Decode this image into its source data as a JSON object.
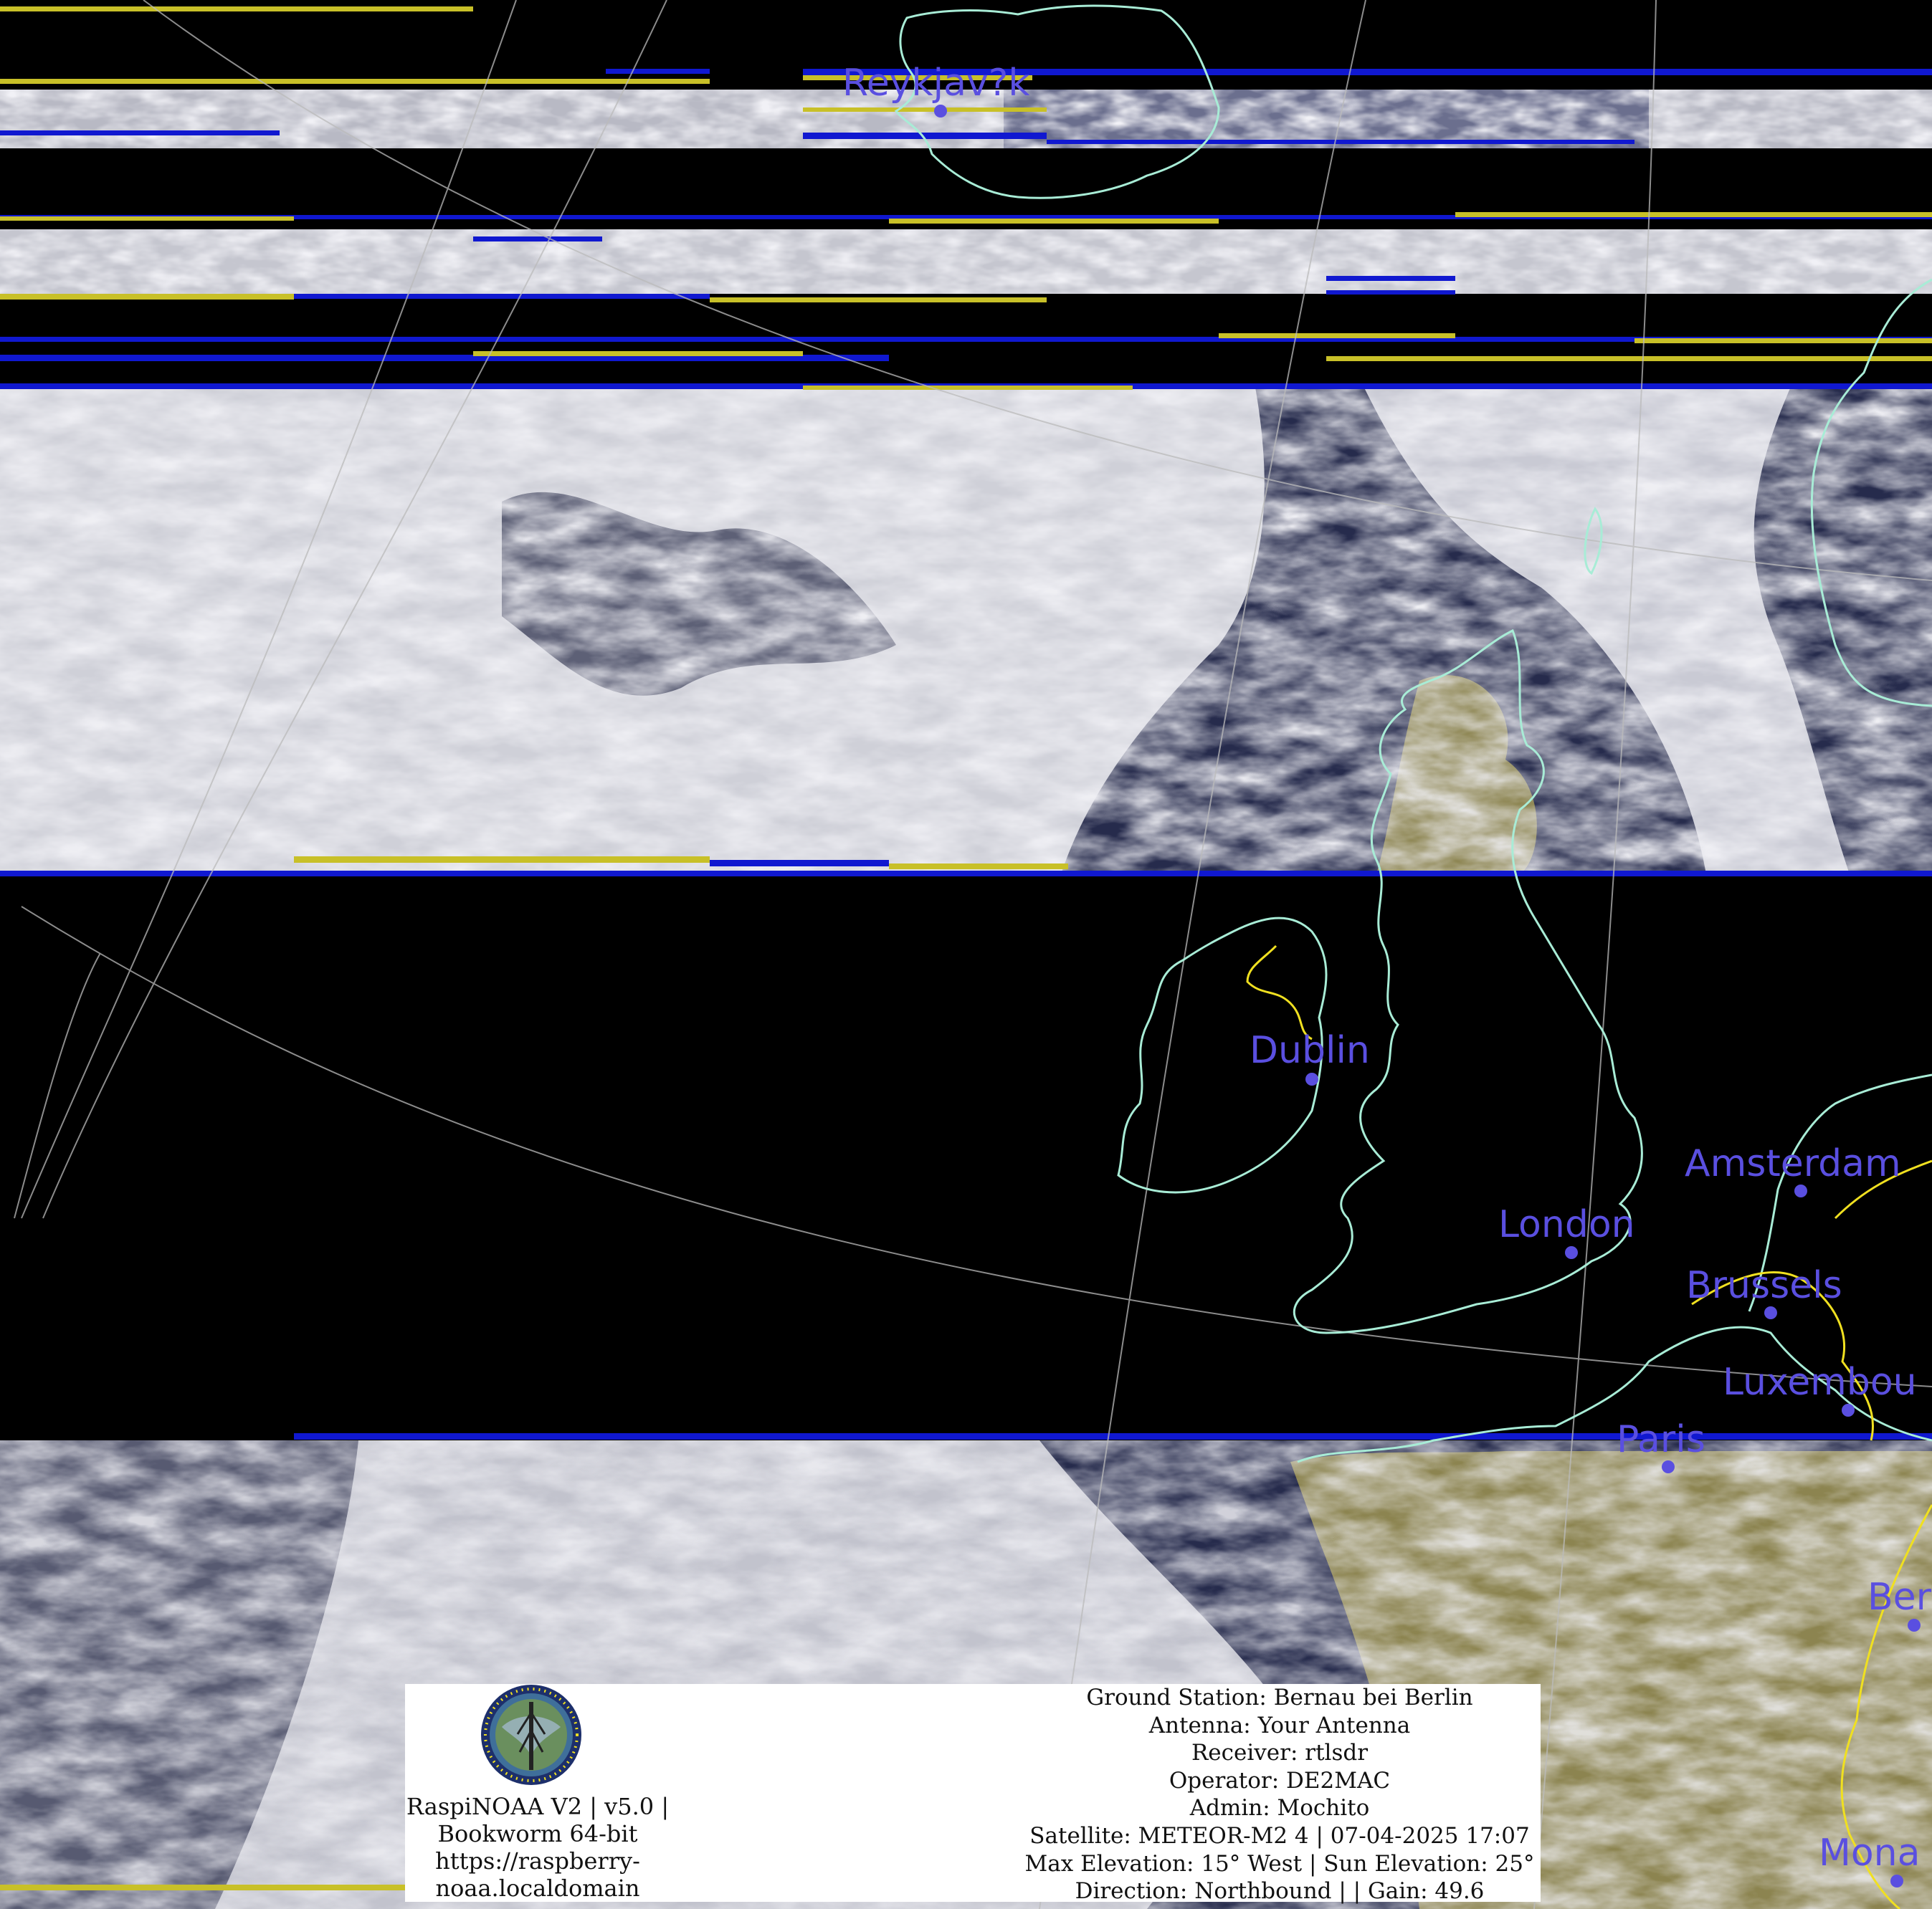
{
  "colors": {
    "coastline": "#a8ecd6",
    "borders": "#f0e020",
    "city_label": "#5a4fe0",
    "land": "#8c8450",
    "ocean": "#262b4c",
    "cloud": "#d9d9df",
    "grid": "#bbbbbb",
    "noise_yellow": "#c8c028",
    "noise_blue": "#1018d0"
  },
  "cities": [
    {
      "name": "Reykjav?k"
    },
    {
      "name": "Dublin"
    },
    {
      "name": "Amsterdam"
    },
    {
      "name": "London"
    },
    {
      "name": "Brussels"
    },
    {
      "name": "Luxembou"
    },
    {
      "name": "Paris"
    },
    {
      "name": "Ber"
    },
    {
      "name": "Mona"
    }
  ],
  "footer": {
    "logo": "raspinoaa-logo",
    "left_lines": [
      "RaspiNOAA V2 | v5.0 |",
      "Bookworm 64-bit",
      "https://raspberry-",
      "noaa.localdomain"
    ],
    "right_lines": [
      "Ground Station: Bernau bei Berlin",
      "Antenna: Your Antenna",
      "Receiver: rtlsdr",
      "Operator: DE2MAC",
      "Admin: Mochito",
      "Satellite: METEOR-M2 4 | 07-04-2025 17:07",
      "Max Elevation: 15° West | Sun Elevation: 25°",
      "Direction: Northbound | | Gain: 49.6"
    ]
  }
}
